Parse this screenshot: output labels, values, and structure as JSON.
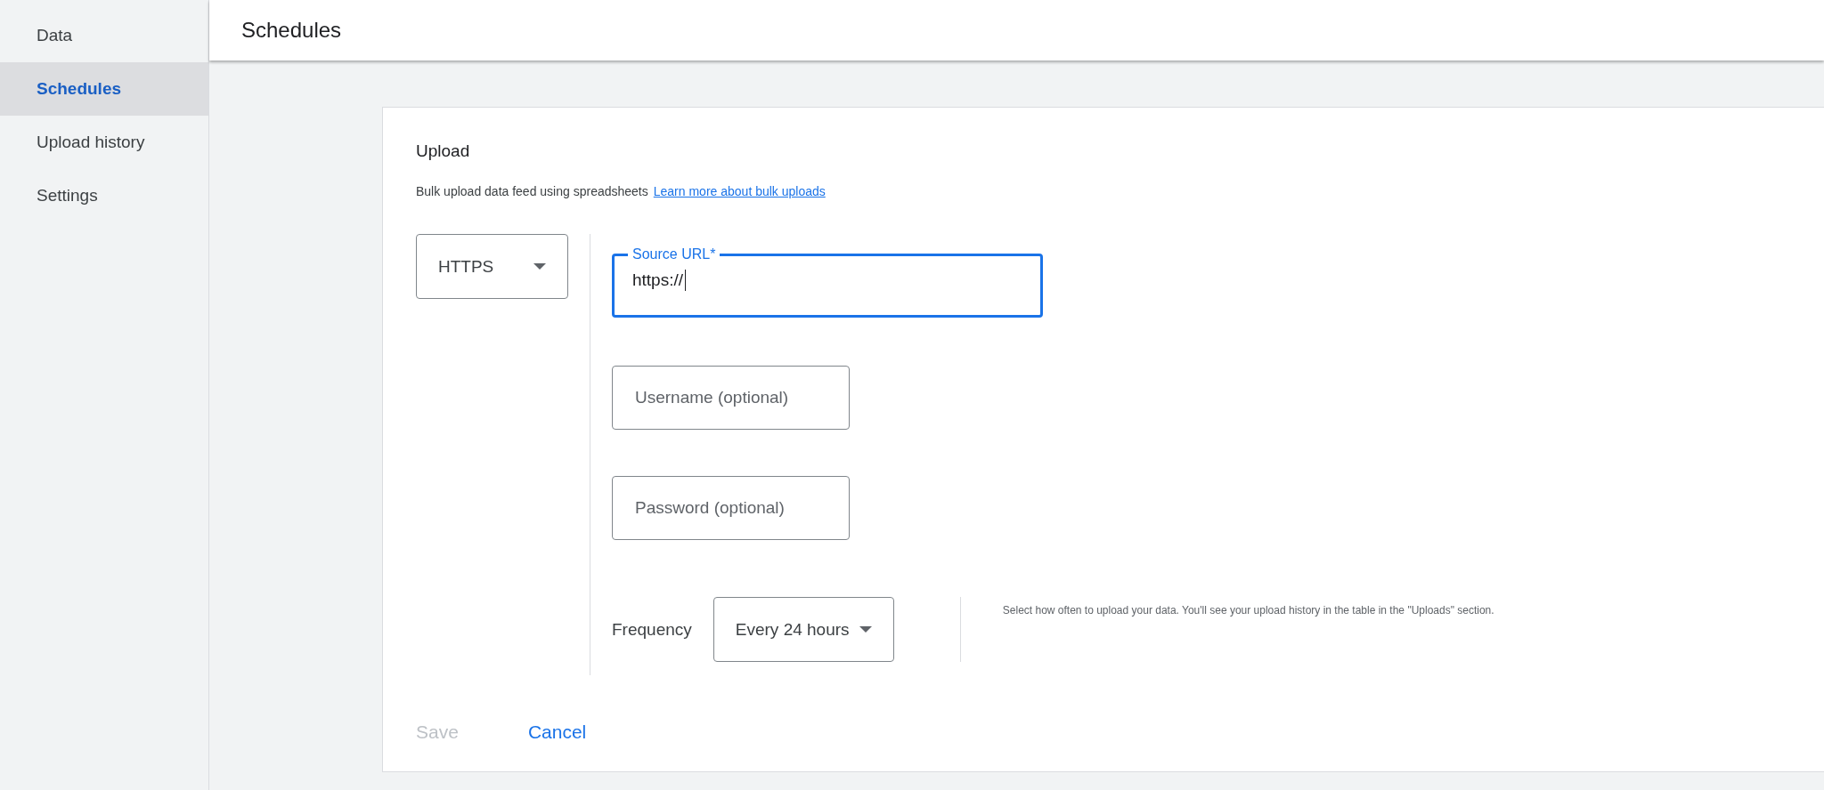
{
  "sidebar": {
    "items": [
      {
        "label": "Data",
        "selected": false
      },
      {
        "label": "Schedules",
        "selected": true
      },
      {
        "label": "Upload history",
        "selected": false
      },
      {
        "label": "Settings",
        "selected": false
      }
    ]
  },
  "header": {
    "title": "Schedules"
  },
  "upload": {
    "title": "Upload",
    "description": "Bulk upload data feed using spreadsheets",
    "link": "Learn more about bulk uploads",
    "protocol": {
      "value": "HTTPS"
    },
    "source_url": {
      "label": "Source URL*",
      "value": "https://",
      "focused": true
    },
    "username": {
      "placeholder": "Username (optional)"
    },
    "password": {
      "placeholder": "Password (optional)"
    },
    "frequency": {
      "label": "Frequency",
      "value": "Every 24 hours",
      "help": "Select how often to upload your data. You'll see your upload history in the table in the \"Uploads\" section."
    },
    "buttons": [
      {
        "label": "Save",
        "disabled": true
      },
      {
        "label": "Cancel",
        "disabled": false
      }
    ]
  }
}
